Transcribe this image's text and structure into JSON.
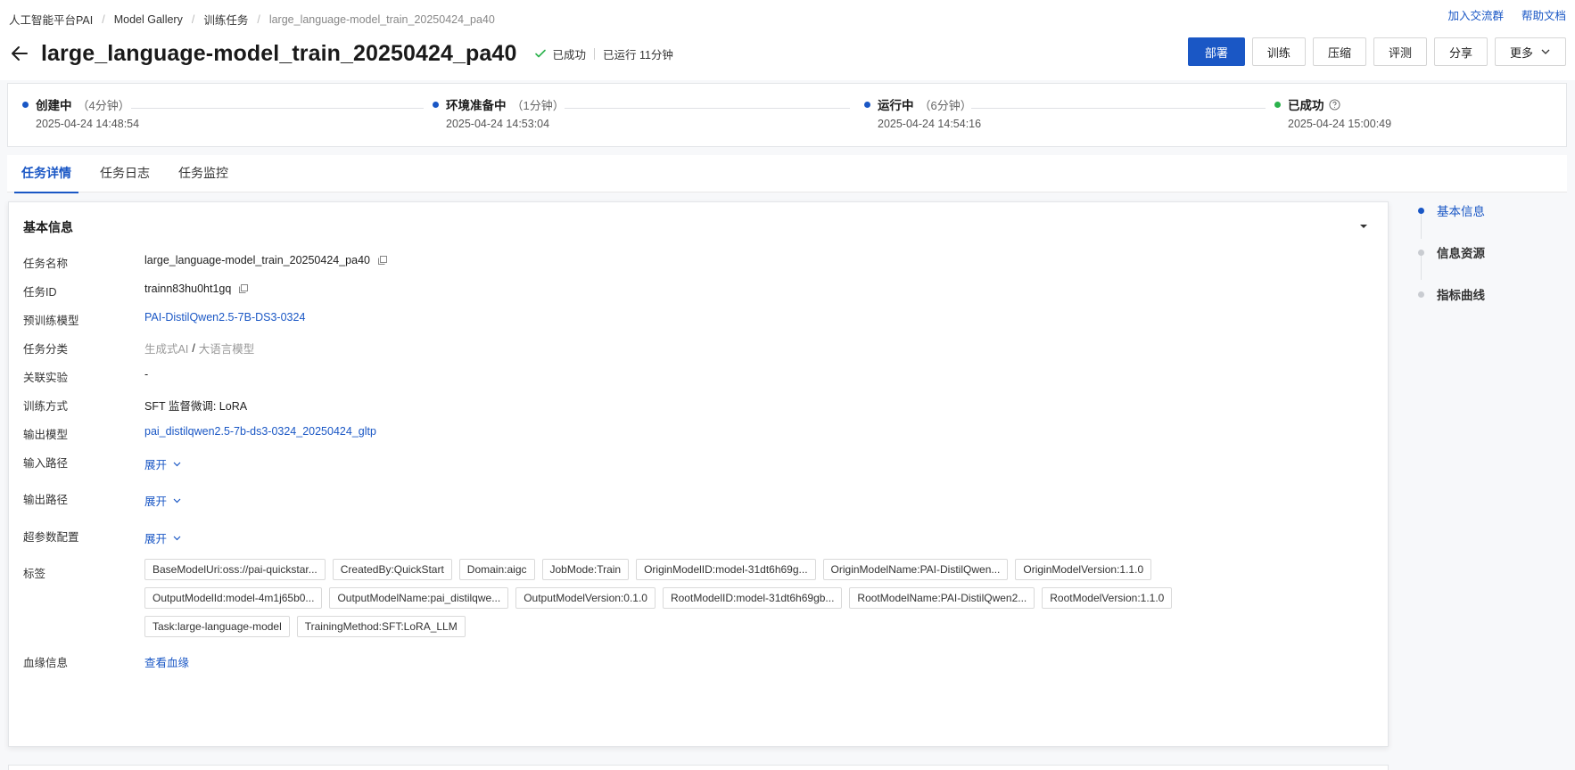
{
  "breadcrumb": [
    "人工智能平台PAI",
    "Model Gallery",
    "训练任务",
    "large_language-model_train_20250424_pa40"
  ],
  "toplinks": {
    "join_group": "加入交流群",
    "help_docs": "帮助文档"
  },
  "header": {
    "title": "large_language-model_train_20250424_pa40",
    "status": "已成功",
    "runtime": "已运行 11分钟"
  },
  "actions": {
    "deploy": "部署",
    "train": "训练",
    "compress": "压缩",
    "evaluate": "评测",
    "share": "分享",
    "more": "更多"
  },
  "steps": [
    {
      "name": "创建中",
      "duration": "（4分钟）",
      "time": "2025-04-24 14:48:54"
    },
    {
      "name": "环境准备中",
      "duration": "（1分钟）",
      "time": "2025-04-24 14:53:04"
    },
    {
      "name": "运行中",
      "duration": "（6分钟）",
      "time": "2025-04-24 14:54:16"
    },
    {
      "name": "已成功",
      "duration": "",
      "time": "2025-04-24 15:00:49"
    }
  ],
  "tabs": [
    "任务详情",
    "任务日志",
    "任务监控"
  ],
  "basic_info": {
    "section_title": "基本信息",
    "task_name_label": "任务名称",
    "task_name": "large_language-model_train_20250424_pa40",
    "task_id_label": "任务ID",
    "task_id": "trainn83hu0ht1gq",
    "pretrained_label": "预训练模型",
    "pretrained": "PAI-DistilQwen2.5-7B-DS3-0324",
    "category_label": "任务分类",
    "category_a": "生成式AI",
    "category_sep": "/",
    "category_b": "大语言模型",
    "experiment_label": "关联实验",
    "experiment": "-",
    "method_label": "训练方式",
    "method": "SFT 监督微调: LoRA",
    "output_model_label": "输出模型",
    "output_model": "pai_distilqwen2.5-7b-ds3-0324_20250424_gltp",
    "input_path_label": "输入路径",
    "output_path_label": "输出路径",
    "hyperparam_label": "超参数配置",
    "expand": "展开",
    "tags_label": "标签",
    "lineage_label": "血缘信息",
    "lineage_link": "查看血缘"
  },
  "tags": [
    "BaseModelUri:oss://pai-quickstar...",
    "CreatedBy:QuickStart",
    "Domain:aigc",
    "JobMode:Train",
    "OriginModelID:model-31dt6h69g...",
    "OriginModelName:PAI-DistilQwen...",
    "OriginModelVersion:1.1.0",
    "OutputModelId:model-4m1j65b0...",
    "OutputModelName:pai_distilqwe...",
    "OutputModelVersion:0.1.0",
    "RootModelID:model-31dt6h69gb...",
    "RootModelName:PAI-DistilQwen2...",
    "RootModelVersion:1.1.0",
    "Task:large-language-model",
    "TrainingMethod:SFT:LoRA_LLM"
  ],
  "anchor_nav": [
    "基本信息",
    "信息资源",
    "指标曲线"
  ],
  "colors": {
    "primary": "#1a57c5",
    "success": "#2bb24c"
  }
}
